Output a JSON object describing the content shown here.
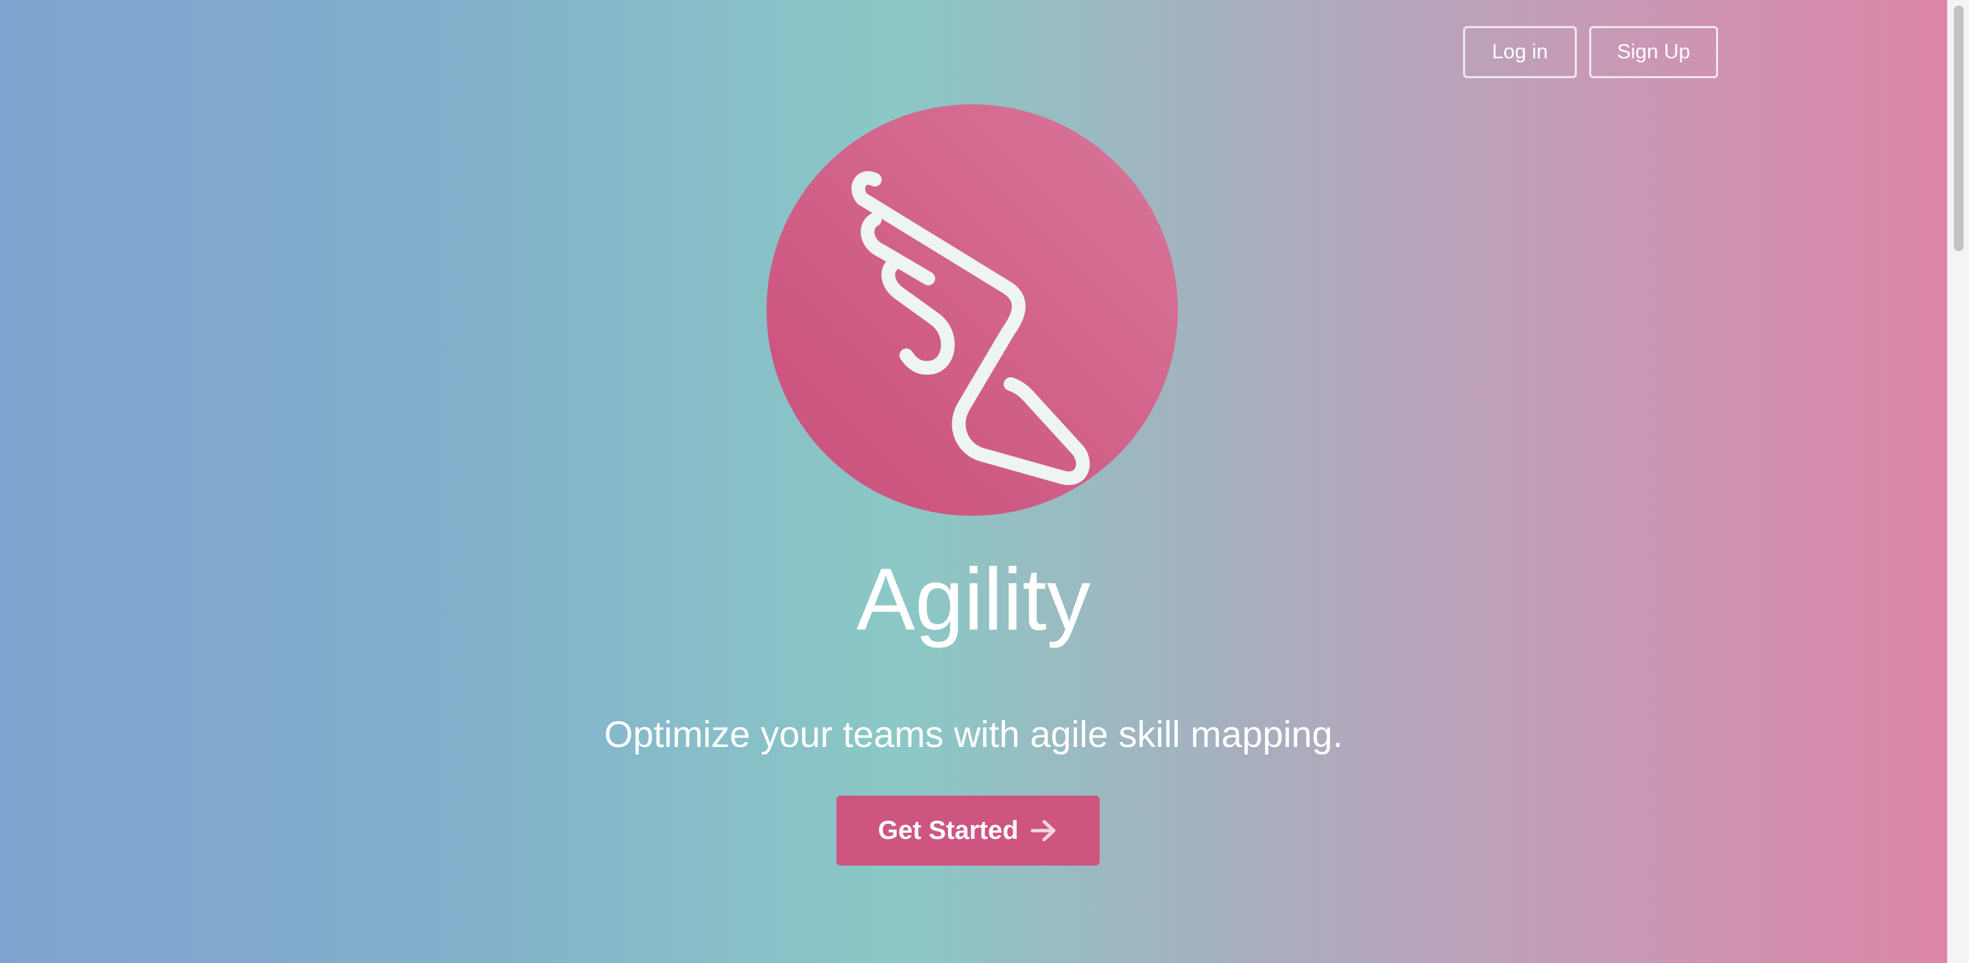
{
  "header": {
    "login_label": "Log in",
    "signup_label": "Sign Up"
  },
  "hero": {
    "title": "Agility",
    "subtitle": "Optimize your teams with agile skill mapping.",
    "cta_label": "Get Started",
    "cta_icon": "arrow-right-icon",
    "logo_icon": "winged-foot-icon"
  },
  "colors": {
    "brand_pink": "#cd5580",
    "gradient_left": "#7fa3d0",
    "gradient_mid": "#8bc8c6",
    "gradient_right": "#de86a8",
    "text": "#ffffff"
  }
}
